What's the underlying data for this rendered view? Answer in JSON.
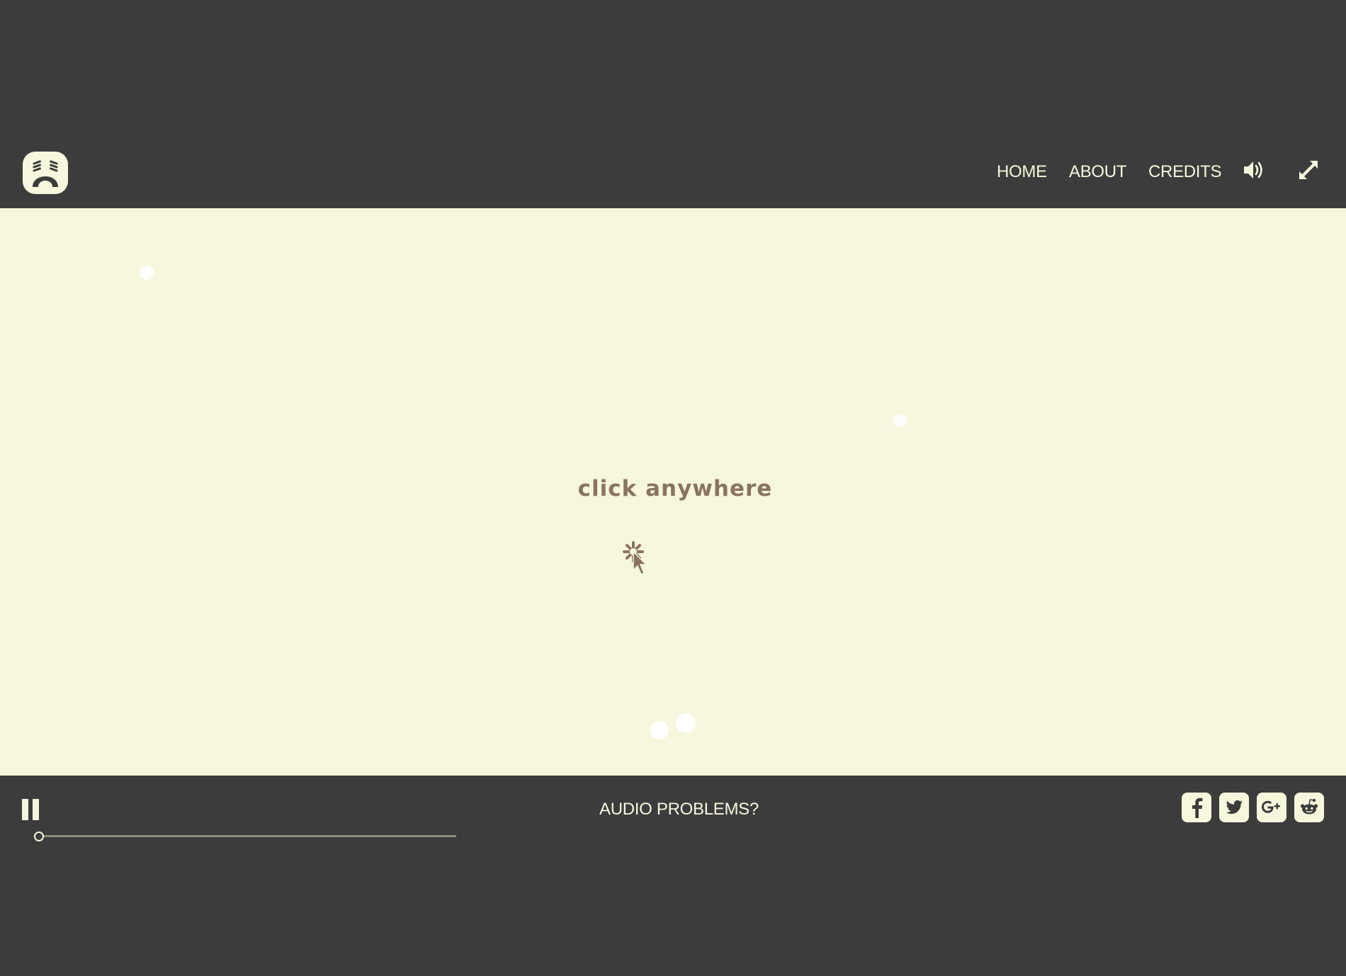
{
  "header": {
    "logo_icon": "bear-face-logo-icon",
    "nav": [
      {
        "label": "HOME"
      },
      {
        "label": "ABOUT"
      },
      {
        "label": "CREDITS"
      }
    ],
    "sound_icon": "speaker-volume-icon",
    "fullscreen_icon": "expand-fullscreen-icon"
  },
  "stage": {
    "prompt": "click anywhere",
    "prompt_icon": "click-cursor-icon"
  },
  "footer": {
    "pause_icon": "pause-icon",
    "audio_link": "AUDIO PROBLEMS?",
    "progress": 0.0,
    "social": [
      {
        "name": "facebook",
        "icon": "facebook-icon"
      },
      {
        "name": "twitter",
        "icon": "twitter-icon"
      },
      {
        "name": "google-plus",
        "icon": "google-plus-icon"
      },
      {
        "name": "reddit",
        "icon": "reddit-icon"
      }
    ]
  },
  "colors": {
    "background_dark": "#3c3c3c",
    "stage_background": "#f6f7dc",
    "accent_light": "#f6f7dc",
    "prompt_text": "#8a7461"
  }
}
